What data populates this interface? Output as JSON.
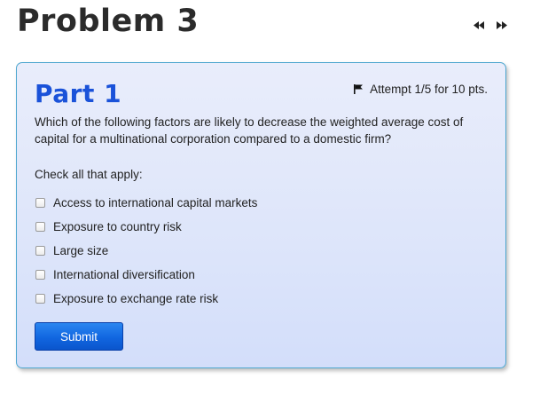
{
  "problem": {
    "title": "Problem 3"
  },
  "nav": {
    "prev_icon": "rewind-icon",
    "next_icon": "fast-forward-icon"
  },
  "part": {
    "title": "Part 1",
    "attempt_icon": "flag-icon",
    "attempt_text": "Attempt 1/5 for 10 pts.",
    "question": "Which of the following factors are likely to decrease the weighted average cost of capital for a multinational corporation compared to a domestic firm?",
    "instruction": "Check all that apply:",
    "options": [
      {
        "label": "Access to international capital markets",
        "checked": false
      },
      {
        "label": "Exposure to country risk",
        "checked": false
      },
      {
        "label": "Large size",
        "checked": false
      },
      {
        "label": "International diversification",
        "checked": false
      },
      {
        "label": "Exposure to exchange rate risk",
        "checked": false
      }
    ],
    "submit_label": "Submit"
  },
  "colors": {
    "part_title": "#1a52d9",
    "card_border": "#4da6cf",
    "submit_bg": "#1166e0"
  }
}
